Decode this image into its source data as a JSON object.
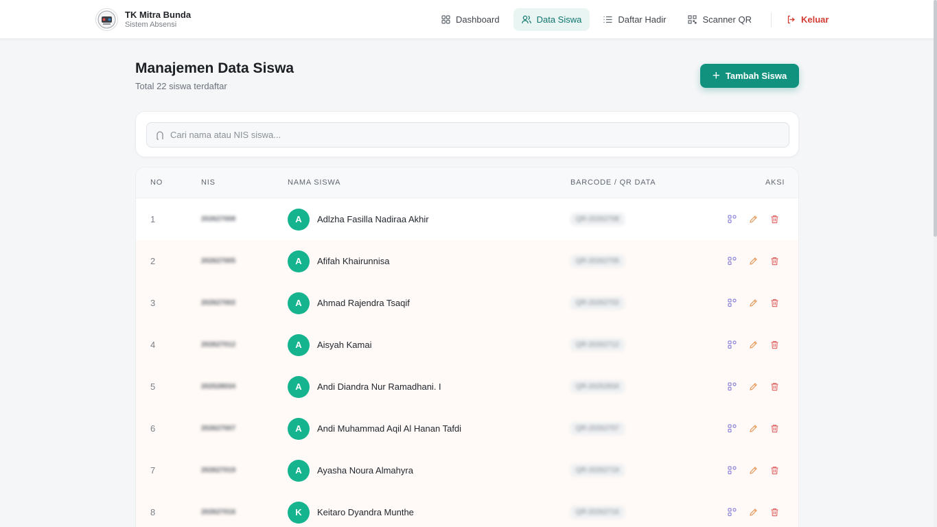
{
  "brand": {
    "title": "TK Mitra Bunda",
    "subtitle": "Sistem Absensi"
  },
  "nav": [
    {
      "label": "Dashboard",
      "icon": "grid-icon"
    },
    {
      "label": "Data Siswa",
      "icon": "users-icon",
      "active": true
    },
    {
      "label": "Daftar Hadir",
      "icon": "list-icon"
    },
    {
      "label": "Scanner QR",
      "icon": "qr-icon"
    }
  ],
  "logout_label": "Keluar",
  "page": {
    "title": "Manajemen Data Siswa",
    "subtitle": "Total 22 siswa terdaftar"
  },
  "add_button_label": "Tambah Siswa",
  "search": {
    "placeholder": "Cari nama atau NIS siswa..."
  },
  "table": {
    "headers": [
      "NO",
      "NIS",
      "NAMA SISWA",
      "BARCODE / QR DATA",
      "AKSI"
    ],
    "rows": [
      {
        "no": "1",
        "nis": "202627008",
        "initial": "A",
        "name": "Adlzha Fasilla Nadiraa Akhir",
        "qr": "QR-20262708"
      },
      {
        "no": "2",
        "nis": "202627005",
        "initial": "A",
        "name": "Afifah Khairunnisa",
        "qr": "QR-20262705"
      },
      {
        "no": "3",
        "nis": "202627002",
        "initial": "A",
        "name": "Ahmad Rajendra Tsaqif",
        "qr": "QR-20262702"
      },
      {
        "no": "4",
        "nis": "202627012",
        "initial": "A",
        "name": "Aisyah Kamai",
        "qr": "QR-20262712"
      },
      {
        "no": "5",
        "nis": "202528034",
        "initial": "A",
        "name": "Andi Diandra Nur Ramadhani. I",
        "qr": "QR-20252834"
      },
      {
        "no": "6",
        "nis": "202627007",
        "initial": "A",
        "name": "Andi Muhammad Aqil Al Hanan Tafdi",
        "qr": "QR-20262707"
      },
      {
        "no": "7",
        "nis": "202627019",
        "initial": "A",
        "name": "Ayasha Noura Almahyra",
        "qr": "QR-20262719"
      },
      {
        "no": "8",
        "nis": "202627016",
        "initial": "K",
        "name": "Keitaro Dyandra Munthe",
        "qr": "QR-20262716"
      }
    ]
  },
  "colors": {
    "accent": "#10927f",
    "avatar": "#15b48f",
    "danger": "#d43b32"
  }
}
